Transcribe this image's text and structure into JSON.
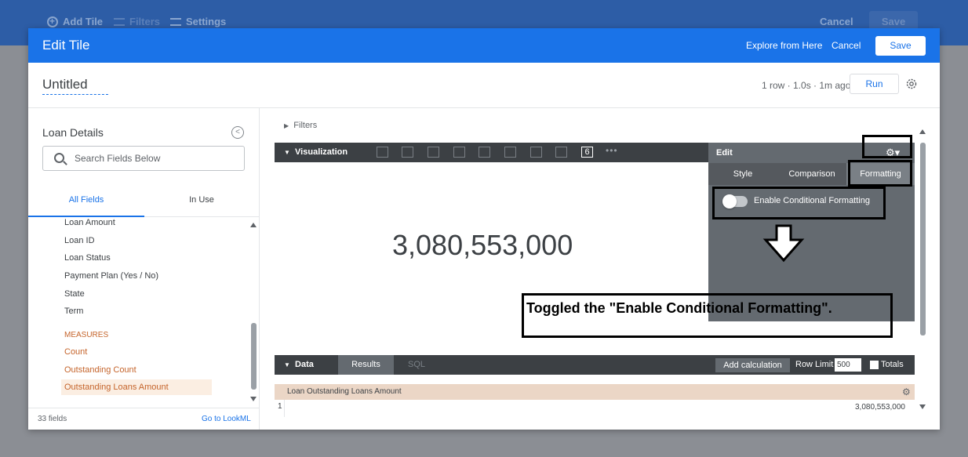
{
  "background": {
    "add_tile": "Add Tile",
    "filters": "Filters",
    "settings": "Settings",
    "cancel": "Cancel",
    "save": "Save"
  },
  "header": {
    "title": "Edit Tile",
    "explore_link": "Explore from Here",
    "cancel": "Cancel",
    "save": "Save"
  },
  "tile": {
    "name": "Untitled",
    "run_info": "1 row · 1.0s · 1m ago",
    "run_label": "Run"
  },
  "field_picker": {
    "explore_name": "Loan Details",
    "search_placeholder": "Search Fields Below",
    "tabs": [
      "All Fields",
      "In Use"
    ],
    "dimensions": [
      "Loan Amount",
      "Loan ID",
      "Loan Status",
      "Payment Plan (Yes / No)",
      "State",
      "Term"
    ],
    "measures_label": "MEASURES",
    "measures": [
      "Count",
      "Outstanding Count",
      "Outstanding Loans Amount"
    ],
    "field_count": "33 fields",
    "lookml_link": "Go to LookML"
  },
  "filters_label": "Filters",
  "visualization": {
    "label": "Visualization",
    "active_icon": "6",
    "more": "•••",
    "value": "3,080,553,000"
  },
  "edit_panel": {
    "title": "Edit",
    "tabs": [
      "Style",
      "Comparison",
      "Formatting"
    ],
    "active_tab": "Formatting",
    "toggle_label": "Enable Conditional Formatting",
    "toggle_on": false
  },
  "annotation": {
    "text": "Toggled the \"Enable Conditional Formatting\"."
  },
  "data": {
    "label": "Data",
    "results_tab": "Results",
    "sql_tab": "SQL",
    "add_calculation": "Add calculation",
    "row_limit_label": "Row Limit",
    "row_limit_value": "500",
    "totals_label": "Totals",
    "column_header": "Loan Outstanding Loans Amount",
    "row_number": "1",
    "row_value": "3,080,553,000"
  },
  "colors": {
    "header_blue": "#1a73e8",
    "dark_bar": "#3c4044",
    "edit_panel": "#646a70",
    "measure_orange": "#c5642b",
    "result_header": "#ebd6c6"
  }
}
